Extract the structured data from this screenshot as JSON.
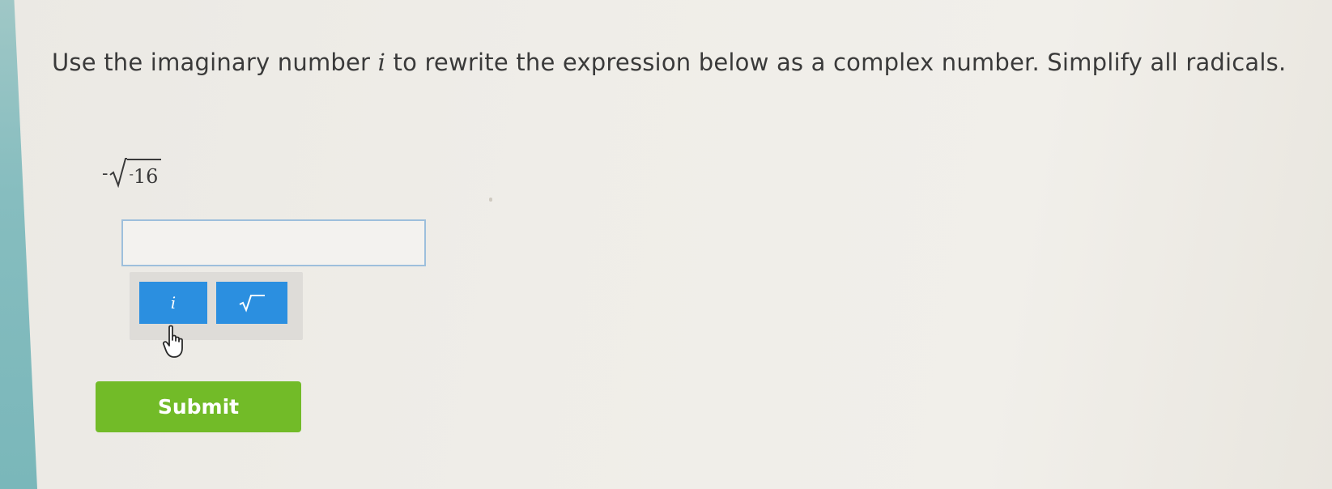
{
  "question": {
    "text_before": "Use the imaginary number ",
    "variable": "i",
    "text_after": " to rewrite the expression below as a complex number. Simplify all radicals."
  },
  "expression": {
    "sign": "-",
    "radicand_sign": "-",
    "radicand_value": "16"
  },
  "answer": {
    "value": "",
    "placeholder": ""
  },
  "keypad": {
    "imaginary_key_label": "i",
    "sqrt_key_icon": "square-root-icon"
  },
  "cursor_icon": "hand-pointer-icon",
  "submit": {
    "label": "Submit"
  },
  "colors": {
    "key_blue": "#2b8fe0",
    "submit_green": "#72bb28",
    "input_border": "#9dbfdc",
    "left_stripe": "#86bdbf"
  }
}
